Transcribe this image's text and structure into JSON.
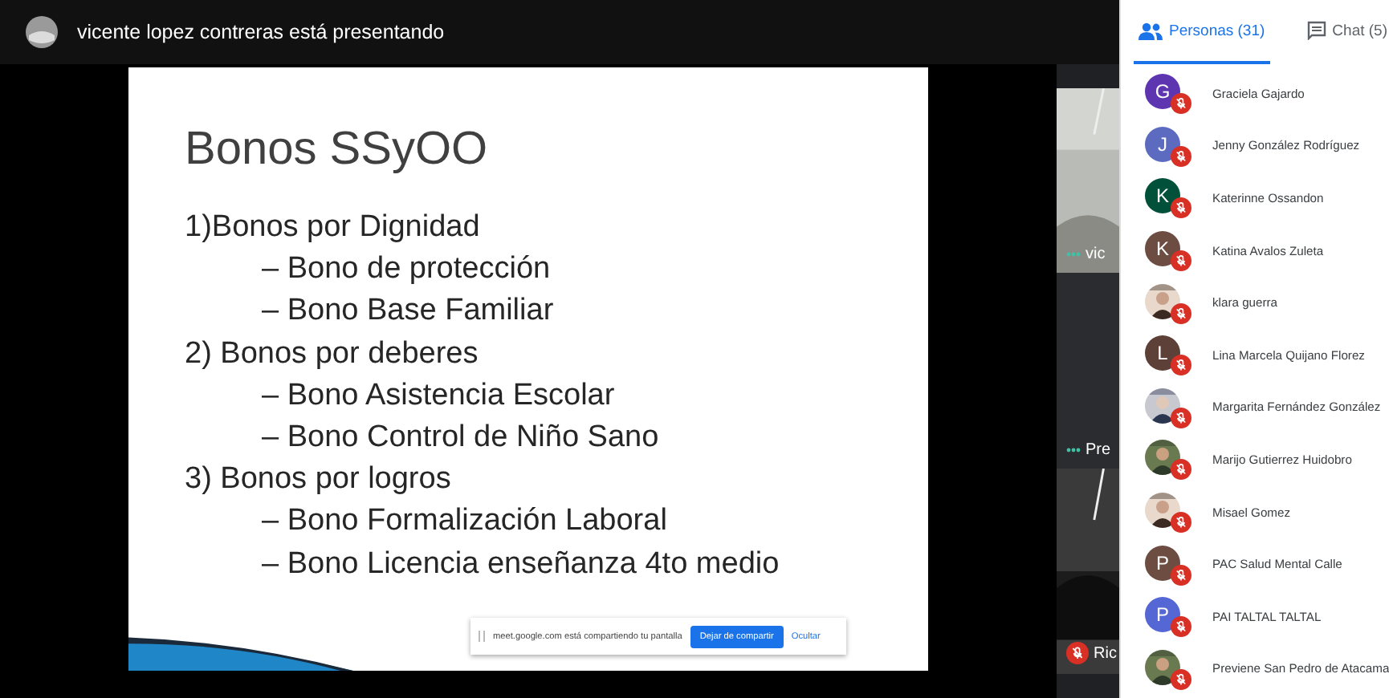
{
  "top_bar": {
    "title": "vicente lopez contreras está presentando"
  },
  "slide": {
    "title": "Bonos SSyOO",
    "items": [
      {
        "text": "1)Bonos por Dignidad",
        "children": [
          {
            "text": "– Bono de protección"
          },
          {
            "text": "– Bono Base Familiar"
          }
        ]
      },
      {
        "text": "2) Bonos por deberes",
        "children": [
          {
            "text": "– Bono Asistencia Escolar"
          },
          {
            "text": "– Bono Control de Niño Sano"
          }
        ]
      },
      {
        "text": "3) Bonos por logros",
        "children": [
          {
            "text": "– Bono Formalización Laboral"
          },
          {
            "text": "– Bono Licencia enseñanza 4to medio"
          }
        ]
      }
    ]
  },
  "share_banner": {
    "message": "meet.google.com está compartiendo tu pantalla",
    "stop_button": "Dejar de compartir",
    "hide_link": "Ocultar"
  },
  "tiles": [
    {
      "kind": "video",
      "label": "vic",
      "muted": false
    },
    {
      "kind": "dark",
      "label": "Pre",
      "muted": false
    },
    {
      "kind": "video",
      "label": "Ric",
      "muted": true
    }
  ],
  "tabs": [
    {
      "label": "Personas (31)",
      "kind": "people",
      "selected": true
    },
    {
      "label": "Chat (5)",
      "kind": "chat",
      "selected": false
    }
  ],
  "participants": [
    {
      "name": "Graciela Gajardo",
      "kind": "letter",
      "initial": "G",
      "color": "#5e35b1",
      "muted": true
    },
    {
      "name": "Jenny González Rodríguez",
      "kind": "letter",
      "initial": "J",
      "color": "#5c6bc0",
      "muted": true
    },
    {
      "name": "Katerinne Ossandon",
      "kind": "letter",
      "initial": "K",
      "color": "#00503a",
      "muted": true
    },
    {
      "name": "Katina Avalos Zuleta",
      "kind": "letter",
      "initial": "K",
      "color": "#6d4c41",
      "muted": true
    },
    {
      "name": "klara guerra",
      "kind": "picture",
      "muted": true
    },
    {
      "name": "Lina Marcela Quijano Florez",
      "kind": "letter",
      "initial": "L",
      "color": "#5d4037",
      "muted": true
    },
    {
      "name": "Margarita Fernández González",
      "kind": "picture",
      "muted": true
    },
    {
      "name": "Marijo Gutierrez Huidobro",
      "kind": "picture",
      "muted": true
    },
    {
      "name": "Misael Gomez",
      "kind": "picture",
      "muted": true
    },
    {
      "name": "PAC Salud Mental Calle",
      "kind": "letter",
      "initial": "P",
      "color": "#6d4c41",
      "muted": true
    },
    {
      "name": "PAI TALTAL TALTAL",
      "kind": "letter",
      "initial": "P",
      "color": "#5467d4",
      "muted": true
    },
    {
      "name": "Previene San Pedro de Atacama",
      "kind": "picture",
      "muted": true
    }
  ]
}
